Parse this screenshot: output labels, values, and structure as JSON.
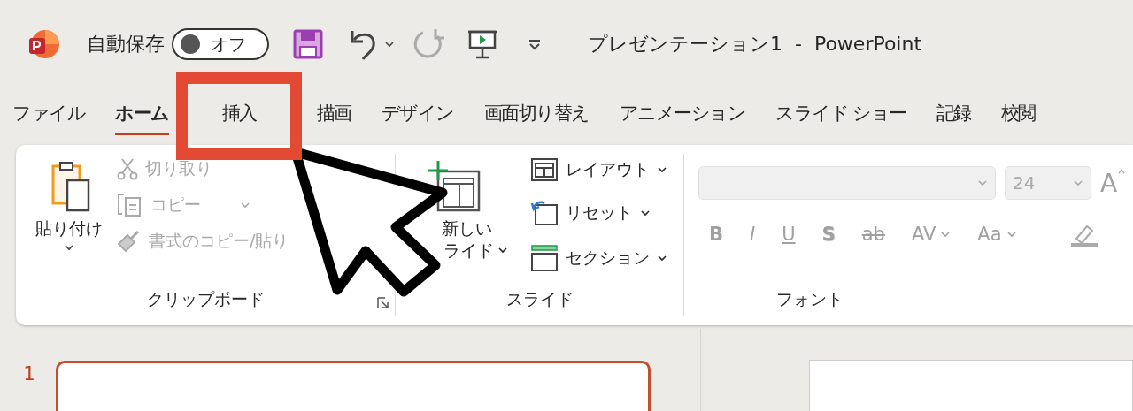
{
  "title_bar": {
    "autosave_label": "自動保存",
    "autosave_state": "オフ",
    "autosave_on": false,
    "document_title": "プレゼンテーション1  -  PowerPoint"
  },
  "tabs": [
    {
      "label": "ファイル",
      "selected": false,
      "highlighted": false
    },
    {
      "label": "ホーム",
      "selected": true,
      "highlighted": false
    },
    {
      "label": "挿入",
      "selected": false,
      "highlighted": true
    },
    {
      "label": "描画",
      "selected": false,
      "highlighted": false
    },
    {
      "label": "デザイン",
      "selected": false,
      "highlighted": false
    },
    {
      "label": "画面切り替え",
      "selected": false,
      "highlighted": false
    },
    {
      "label": "アニメーション",
      "selected": false,
      "highlighted": false
    },
    {
      "label": "スライド ショー",
      "selected": false,
      "highlighted": false
    },
    {
      "label": "記録",
      "selected": false,
      "highlighted": false
    },
    {
      "label": "校閲",
      "selected": false,
      "highlighted": false
    }
  ],
  "ribbon": {
    "clipboard": {
      "paste_label": "貼り付け",
      "items": [
        {
          "kind": "cut",
          "label": "切り取り",
          "disabled": true
        },
        {
          "kind": "copy",
          "label": "コピー",
          "disabled": true
        },
        {
          "kind": "painter",
          "label": "書式のコピー/貼り",
          "disabled": true
        }
      ],
      "group_label": "クリップボード"
    },
    "slides": {
      "new_slide_label": [
        "新しい",
        "ライド"
      ],
      "items": [
        {
          "kind": "layout",
          "label": "レイアウト"
        },
        {
          "kind": "reset",
          "label": "リセット"
        },
        {
          "kind": "section",
          "label": "セクション"
        }
      ],
      "group_label": "スライド"
    },
    "font": {
      "font_size": "24",
      "grow_label": "A",
      "buttons": [
        {
          "kind": "bold",
          "label": "B"
        },
        {
          "kind": "italic",
          "label": "I"
        },
        {
          "kind": "underline",
          "label": "U"
        },
        {
          "kind": "shadow",
          "label": "S"
        },
        {
          "kind": "strike",
          "label": "ab"
        },
        {
          "kind": "spacing",
          "label": "AV"
        },
        {
          "kind": "case",
          "label": "Aa"
        }
      ],
      "group_label": "フォント"
    }
  },
  "slide_panel": {
    "slides": [
      {
        "number": "1",
        "selected": true
      }
    ]
  }
}
